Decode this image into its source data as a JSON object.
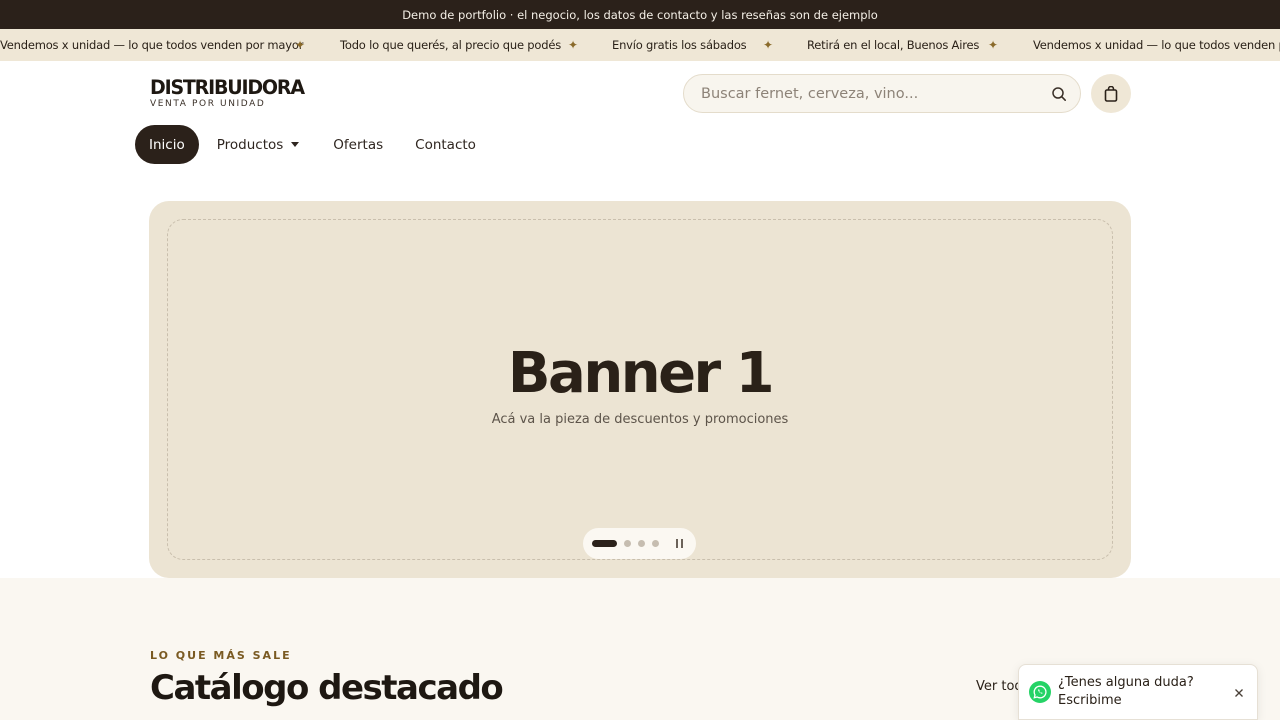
{
  "notice": {
    "text": "Demo de portfolio · el negocio, los datos de contacto y las reseñas son de ejemplo"
  },
  "marquee": {
    "items": [
      "Vendemos x unidad — lo que todos venden por mayor",
      "Todo lo que querés, al precio que podés",
      "Envío gratis los sábados",
      "Retirá en el local, Buenos Aires",
      "Vendemos x unidad — lo que todos venden por mayor"
    ],
    "separator": "✦"
  },
  "header": {
    "logo_text": "DISTRIBUIDORA",
    "logo_tagline": "VENTA POR UNIDAD",
    "search_placeholder": "Buscar fernet, cerveza, vino..."
  },
  "nav": {
    "items": [
      {
        "label": "Inicio",
        "active": true
      },
      {
        "label": "Productos",
        "dropdown": true
      },
      {
        "label": "Ofertas"
      },
      {
        "label": "Contacto"
      }
    ]
  },
  "banner": {
    "title": "Banner 1",
    "subtitle": "Acá va la pieza de descuentos y promociones",
    "slide_count": 4,
    "active_slide": 1
  },
  "catalog": {
    "eyebrow": "LO QUE MÁS SALE",
    "heading": "Catálogo destacado",
    "see_all": "Ver todo"
  },
  "chat": {
    "line1": "¿Tenes alguna duda?",
    "line2": "Escribime"
  },
  "colors": {
    "dark": "#2b211a",
    "cream": "#efe7d6",
    "banner_bg": "#ece4d3",
    "accent": "#7a5a22",
    "whatsapp": "#25d366"
  }
}
